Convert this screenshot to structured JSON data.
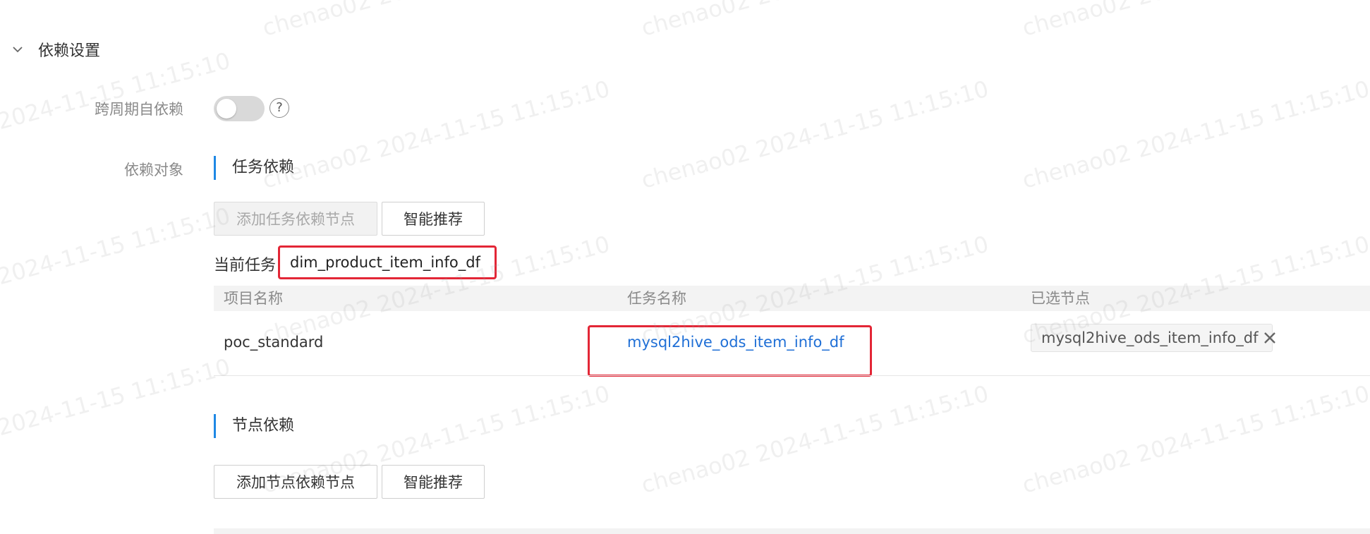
{
  "watermark": {
    "text": "chenao02 2024-11-15 11:15:10"
  },
  "section": {
    "title": "依赖设置"
  },
  "cross_cycle": {
    "label": "跨周期自依赖",
    "enabled": false,
    "help": "?"
  },
  "dependency_object": {
    "label": "依赖对象"
  },
  "task_dependency": {
    "title": "任务依赖",
    "add_button": "添加任务依赖节点",
    "recommend_button": "智能推荐",
    "current_task_label": "当前任务",
    "current_task_value": "dim_product_item_info_df",
    "columns": [
      "项目名称",
      "任务名称",
      "已选节点"
    ],
    "rows": [
      {
        "project": "poc_standard",
        "task": "mysql2hive_ods_item_info_df",
        "selected": "mysql2hive_ods_item_info_df"
      }
    ]
  },
  "node_dependency": {
    "title": "节点依赖",
    "add_button": "添加节点依赖节点",
    "recommend_button": "智能推荐"
  },
  "colors": {
    "accent": "#1e88e5",
    "link": "#1f6fd6",
    "highlight": "#e32636"
  }
}
